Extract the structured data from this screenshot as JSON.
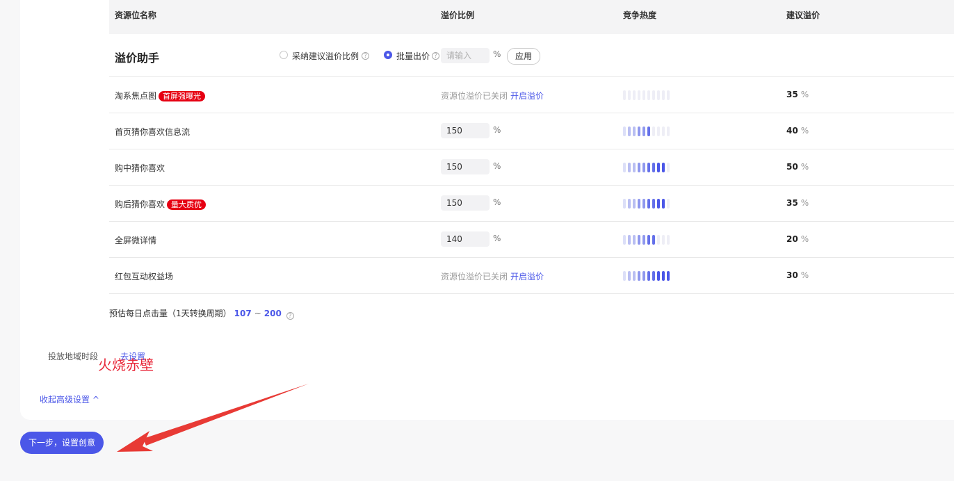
{
  "header": {
    "col_name": "资源位名称",
    "col_ratio": "溢价比例",
    "col_heat": "竞争热度",
    "col_suggest": "建议溢价"
  },
  "helper": {
    "title": "溢价助手",
    "option_adopt": "采纳建议溢价比例",
    "option_batch": "批量出价",
    "selected_option": "批量出价",
    "input_placeholder": "请输入",
    "percent_sign": "%",
    "apply_label": "应用"
  },
  "rows": [
    {
      "name": "淘系焦点图",
      "tag": "首屏强曝光",
      "ratio": "",
      "closed_text": "资源位溢价已关闭",
      "open_link": "开启溢价",
      "heat": 0,
      "suggest": "35",
      "pct": "%"
    },
    {
      "name": "首页猜你喜欢信息流",
      "tag": "",
      "ratio": "150",
      "closed_text": "",
      "open_link": "",
      "heat": 6,
      "suggest": "40",
      "pct": "%"
    },
    {
      "name": "购中猜你喜欢",
      "tag": "",
      "ratio": "150",
      "closed_text": "",
      "open_link": "",
      "heat": 9,
      "suggest": "50",
      "pct": "%"
    },
    {
      "name": "购后猜你喜欢",
      "tag": "量大质优",
      "ratio": "150",
      "closed_text": "",
      "open_link": "",
      "heat": 9,
      "suggest": "35",
      "pct": "%"
    },
    {
      "name": "全屏微详情",
      "tag": "",
      "ratio": "140",
      "closed_text": "",
      "open_link": "",
      "heat": 7,
      "suggest": "20",
      "pct": "%"
    },
    {
      "name": "红包互动权益场",
      "tag": "",
      "ratio": "",
      "closed_text": "资源位溢价已关闭",
      "open_link": "开启溢价",
      "heat": 10,
      "suggest": "30",
      "pct": "%"
    }
  ],
  "estimate": {
    "label": "预估每日点击量（1天转换周期）",
    "low": "107",
    "tilde": "~",
    "high": "200"
  },
  "region": {
    "label": "投放地域时段",
    "link": "去设置"
  },
  "watermark": "火烧赤壁",
  "collapse_label": "收起高级设置 ^",
  "next_button": "下一步，设置创意",
  "colors": {
    "accent": "#4b57e8",
    "tag_red": "#e60012",
    "background": "#f7f7f8"
  }
}
